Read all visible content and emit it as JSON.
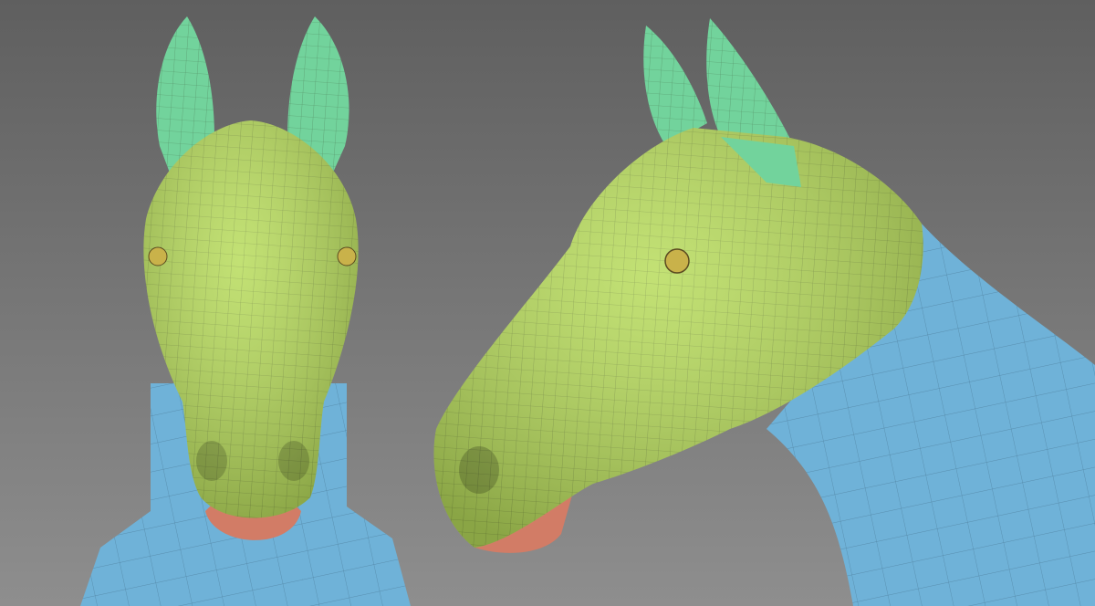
{
  "scene": {
    "subject": "horse-head-polygroups",
    "views": [
      "front",
      "side"
    ]
  },
  "colors": {
    "background_top": "#5f5f5f",
    "background_bottom": "#8e8e8e",
    "head": "#b8dc5c",
    "ears": "#72d39c",
    "neck": "#6fb2d8",
    "lips": "#d27c66",
    "eye": "#c9b24a",
    "wire": "#2f3a1f"
  }
}
